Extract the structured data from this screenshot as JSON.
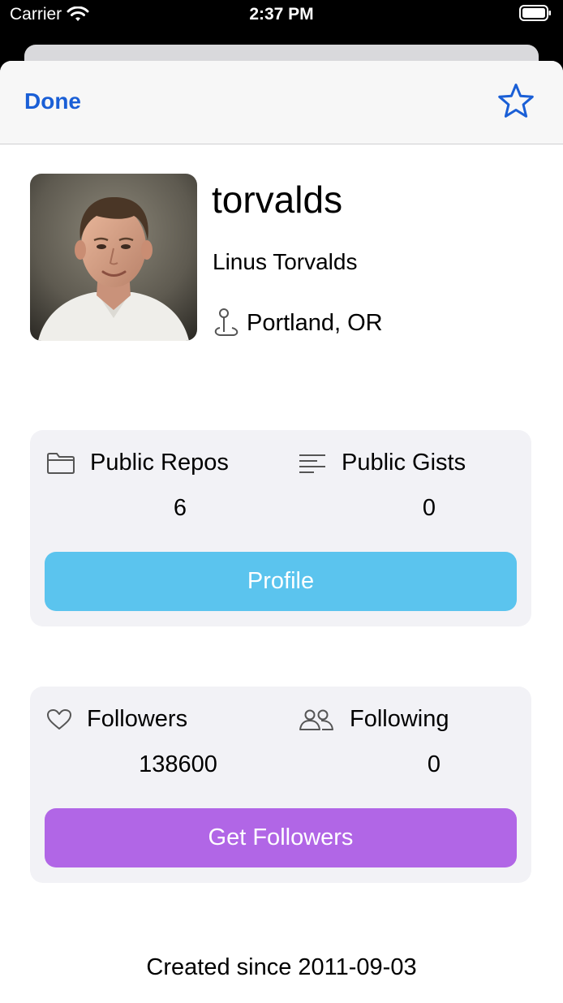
{
  "status_bar": {
    "carrier": "Carrier",
    "time": "2:37 PM",
    "icons": [
      "wifi-icon",
      "battery-icon"
    ]
  },
  "nav": {
    "done_label": "Done",
    "favorite_icon": "star-icon",
    "accent_color": "#1a5fd6"
  },
  "profile": {
    "avatar": "profile-photo",
    "username": "torvalds",
    "name": "Linus Torvalds",
    "location_icon": "map-pin-icon",
    "location": "Portland, OR"
  },
  "repos_card": {
    "repos_icon": "folder-icon",
    "repos_label": "Public Repos",
    "repos_value": "6",
    "gists_icon": "text-lines-icon",
    "gists_label": "Public Gists",
    "gists_value": "0",
    "button_label": "Profile",
    "button_color": "#5bc4ee"
  },
  "followers_card": {
    "followers_icon": "heart-icon",
    "followers_label": "Followers",
    "followers_value": "138600",
    "following_icon": "people-icon",
    "following_label": "Following",
    "following_value": "0",
    "button_label": "Get Followers",
    "button_color": "#b166e6"
  },
  "footer": {
    "created_text": "Created since 2011-09-03"
  }
}
